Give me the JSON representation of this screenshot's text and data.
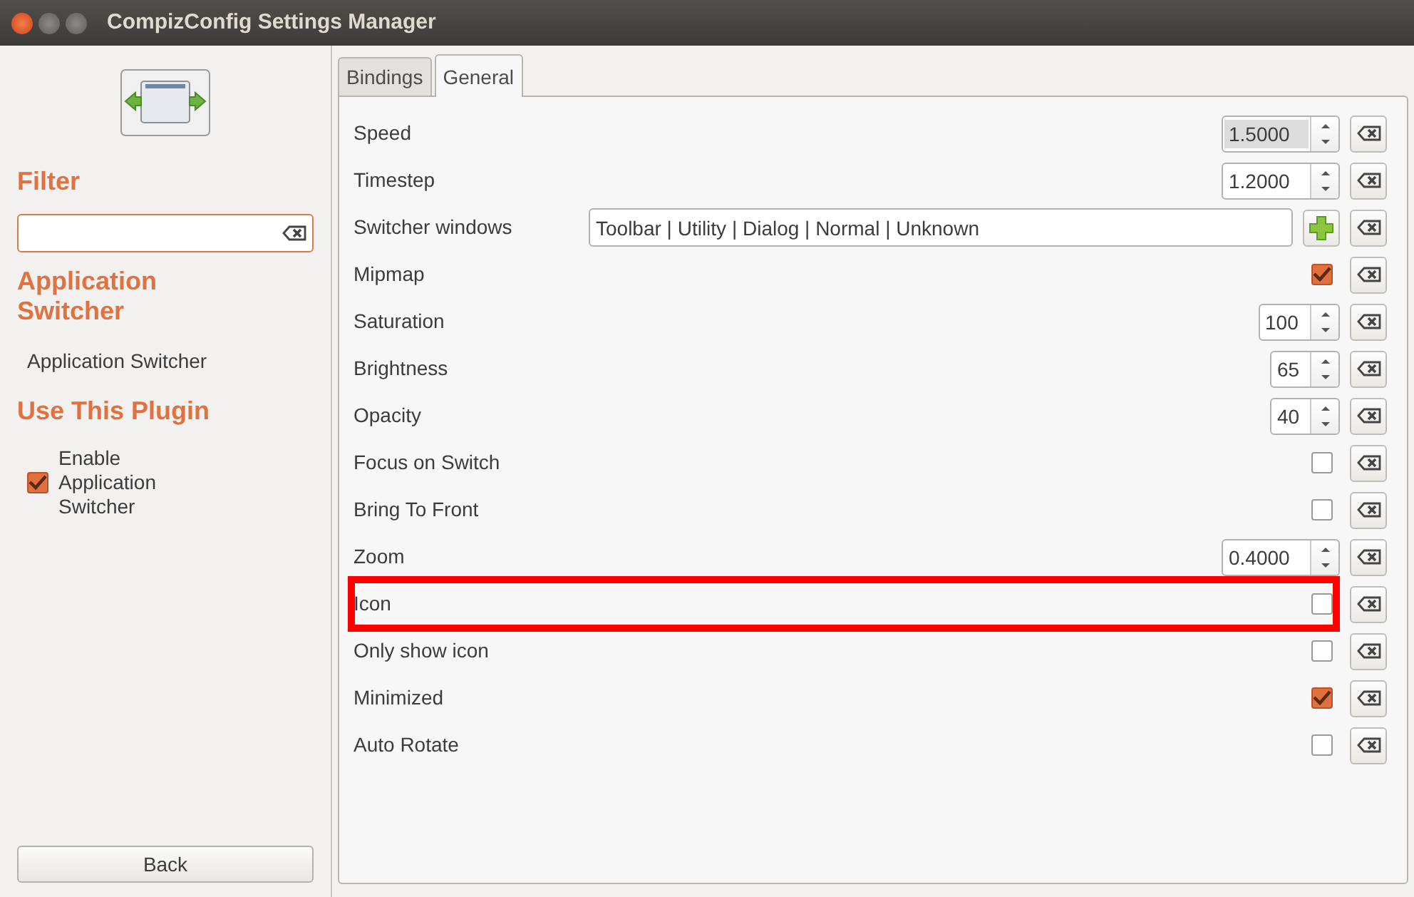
{
  "window": {
    "title": "CompizConfig Settings Manager"
  },
  "sidebar": {
    "filter_heading": "Filter",
    "plugin_heading": "Application Switcher",
    "plugin_name": "Application Switcher",
    "use_heading": "Use This Plugin",
    "enable": {
      "label": "Enable Application Switcher",
      "checked": true
    },
    "back_button": "Back"
  },
  "tabs": [
    {
      "label": "Bindings",
      "selected": false
    },
    {
      "label": "General",
      "selected": true
    }
  ],
  "settings": [
    {
      "kind": "spin",
      "label": "Speed",
      "value": "1.5000",
      "text_selected": true,
      "highlighted": false
    },
    {
      "kind": "spin",
      "label": "Timestep",
      "value": "1.2000",
      "text_selected": false,
      "highlighted": false
    },
    {
      "kind": "list",
      "label": "Switcher windows",
      "value": "Toolbar | Utility | Dialog | Normal | Unknown",
      "highlighted": false
    },
    {
      "kind": "checkbox",
      "label": "Mipmap",
      "checked": true,
      "highlighted": false
    },
    {
      "kind": "spin",
      "label": "Saturation",
      "value": "100",
      "text_selected": false,
      "highlighted": false
    },
    {
      "kind": "spin",
      "label": "Brightness",
      "value": "65",
      "text_selected": false,
      "highlighted": false
    },
    {
      "kind": "spin",
      "label": "Opacity",
      "value": "40",
      "text_selected": false,
      "highlighted": false
    },
    {
      "kind": "checkbox",
      "label": "Focus on Switch",
      "checked": false,
      "highlighted": false
    },
    {
      "kind": "checkbox",
      "label": "Bring To Front",
      "checked": false,
      "highlighted": false
    },
    {
      "kind": "spin",
      "label": "Zoom",
      "value": "0.4000",
      "text_selected": false,
      "highlighted": false
    },
    {
      "kind": "checkbox",
      "label": "Icon",
      "checked": false,
      "highlighted": true
    },
    {
      "kind": "checkbox",
      "label": "Only show icon",
      "checked": false,
      "highlighted": false
    },
    {
      "kind": "checkbox",
      "label": "Minimized",
      "checked": true,
      "highlighted": false
    },
    {
      "kind": "checkbox",
      "label": "Auto Rotate",
      "checked": false,
      "highlighted": false
    }
  ]
}
